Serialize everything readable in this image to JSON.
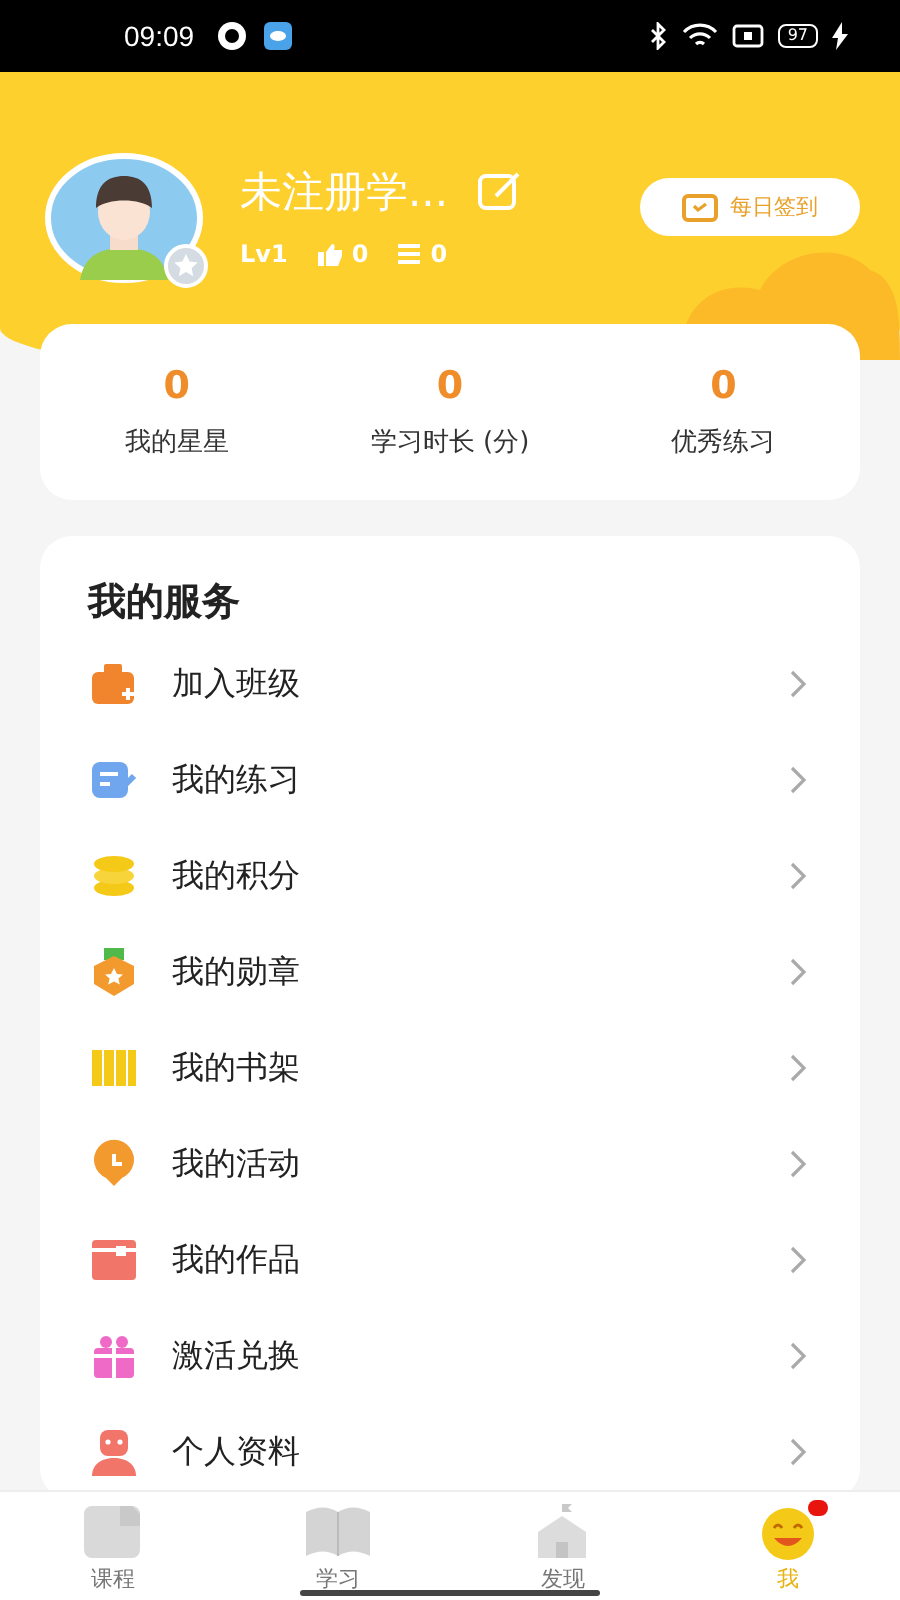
{
  "status_bar": {
    "time": "09:09",
    "battery": "97"
  },
  "profile": {
    "name": "未注册学...",
    "level": "Lv1",
    "likes": "0",
    "posts": "0",
    "checkin_button": "每日签到"
  },
  "stats": [
    {
      "value": "0",
      "label": "我的星星"
    },
    {
      "value": "0",
      "label": "学习时长 (分)"
    },
    {
      "value": "0",
      "label": "优秀练习"
    }
  ],
  "services": {
    "title": "我的服务",
    "items": [
      {
        "label": "加入班级"
      },
      {
        "label": "我的练习"
      },
      {
        "label": "我的积分"
      },
      {
        "label": "我的勋章"
      },
      {
        "label": "我的书架"
      },
      {
        "label": "我的活动"
      },
      {
        "label": "我的作品"
      },
      {
        "label": "激活兑换"
      },
      {
        "label": "个人资料"
      }
    ]
  },
  "tabs": [
    {
      "label": "课程",
      "selected": false,
      "badge": false
    },
    {
      "label": "学习",
      "selected": false,
      "badge": false
    },
    {
      "label": "发现",
      "selected": false,
      "badge": false
    },
    {
      "label": "我",
      "selected": true,
      "badge": true
    }
  ]
}
